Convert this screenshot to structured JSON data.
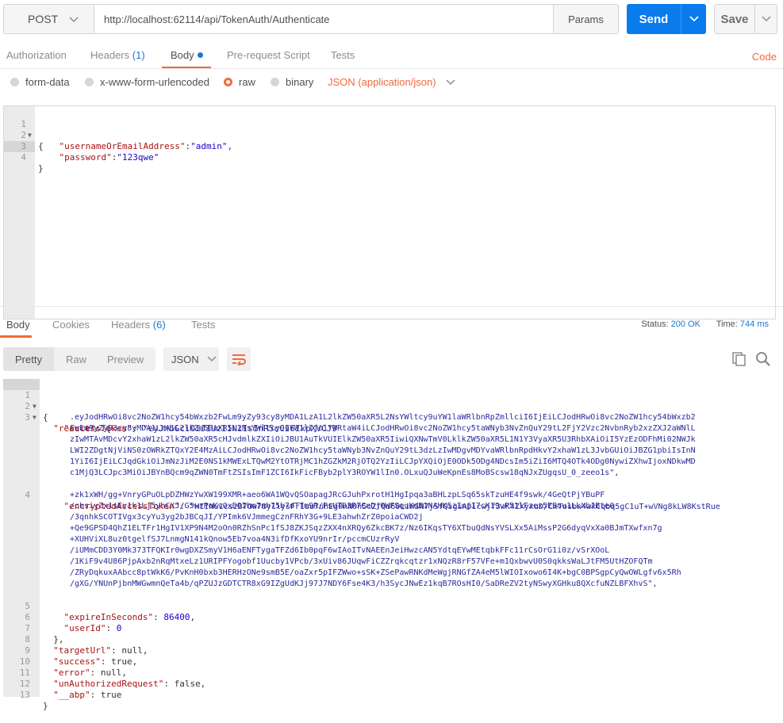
{
  "request": {
    "method": "POST",
    "url": "http://localhost:62114/api/TokenAuth/Authenticate",
    "params_label": "Params",
    "send_label": "Send",
    "save_label": "Save"
  },
  "request_tabs": {
    "authorization": "Authorization",
    "headers": "Headers",
    "headers_count": "(1)",
    "body": "Body",
    "prerequest": "Pre-request Script",
    "tests": "Tests",
    "code": "Code"
  },
  "body_types": {
    "form_data": "form-data",
    "urlencoded": "x-www-form-urlencoded",
    "raw": "raw",
    "binary": "binary",
    "content_type": "JSON (application/json)"
  },
  "request_body": {
    "lines": [
      "1",
      "2",
      "3",
      "4"
    ],
    "l1": "{",
    "l2_key": "\"usernameOrEmailAddress\"",
    "l2_sep": ":",
    "l2_val": "\"admin\"",
    "l2_end": ",",
    "l3_key": "\"password\"",
    "l3_sep": ":",
    "l3_val": "\"123qwe\"",
    "l4": "}"
  },
  "response_tabs": {
    "body": "Body",
    "cookies": "Cookies",
    "headers": "Headers",
    "headers_count": "(6)",
    "tests": "Tests",
    "status_label": "Status:",
    "status_value": "200 OK",
    "time_label": "Time:",
    "time_value": "744 ms"
  },
  "response_toolbar": {
    "pretty": "Pretty",
    "raw": "Raw",
    "preview": "Preview",
    "format": "JSON"
  },
  "response_body": {
    "n1": "1",
    "n2": "2",
    "n3": "3",
    "n4": "4",
    "n5": "5",
    "n6": "6",
    "n7": "7",
    "n8": "8",
    "n9": "9",
    "n10": "10",
    "n11": "11",
    "n12": "12",
    "n13": "13",
    "l1": "{",
    "l2_key": "\"result\"",
    "l2_rest": ": {",
    "l3_key": "\"accessToken\"",
    "l3_val": "\"eyJhbGciOiJIUzI1NiIsInR5cCI6IkpXVCJ9",
    "l3_w1": ".eyJodHRwOi8vc2NoZW1hcy54bWxzb2FwLm9yZy93cy8yMDA1LzA1L2lkZW50aXR5L2NsYWltcy9uYW1laWRlbnRpZmllciI6IjEiLCJodHRwOi8vc2NoZW1hcy54bWxzb2",
    "l3_w2": "FwLm9yZy93cy8yMDA1LzA1L2lkZW50aXR5L2NsYWltcy9uYW1lIjoiYWRtaW4iLCJodHRwOi8vc2NoZW1hcy5taWNyb3NvZnQuY29tL2FjY2Vzc2NvbnRyb2xzZXJ2aWNlL",
    "l3_w3": "zIwMTAvMDcvY2xhaW1zL2lkZW50aXR5cHJvdmlkZXIiOiJBU1AuTkVUIElkZW50aXR5IiwiQXNwTmV0LklkZW50aXR5L1N1Y3VyaXR5U3RhbXAiOiI5YzEzODFhMi02NWJk",
    "l3_w4": "LWI2ZDgtNjViNS0zOWRkZTQxY2E4MzAiLCJodHRwOi8vc2NoZW1hcy5taWNyb3NvZnQuY29tL3dzLzIwMDgvMDYvaWRlbnRpdHkvY2xhaW1zL3JvbGUiOiJBZG1pbiIsInN",
    "l3_w5": "1YiI6IjEiLCJqdGkiOiJmNzJiM2E0NS1kMWExLTQwM2YtOTRjMC1hZGZkM2RjOTQ2YzIiLCJpYXQiOjE0ODk5ODg4NDcsIm5iZiI6MTQ4OTk4ODg0NywiZXhwIjoxNDkwMD",
    "l3_w6": "c1MjQ3LCJpc3MiOiJBYnBQcm9qZWN0TmFtZSIsImF1ZCI6IkFicFByb2plY3ROYW1lIn0.OLxuQJuWeKpnEs8MoBScsw18qNJxZUgqsU_0_zeeo1s\",",
    "l4_key": "\"encryptedAccessToken\"",
    "l4_val": "\"HIINu1cszB7Ow78y1lysFr1uu7uhEg0nNOh5cZfQd60LiWSN7jSfQsgsADicwjf3wK4ZXyxuD/CxTosbw4wkCqbq5gC1uT+wVNg8kLW8KstRue",
    "l4_w1": "+zk1xWH/gg+VnryGPuOLpDZHWzYwXW199XMR+aeo6WA1WQvQSOapagJRcGJuhPxrotH1HgIpqa3aBHLzpLSq65skTzuHE4f9swk/4GeQtPjYBuPF",
    "l4_w2": "/chsiyZx1sEv1k1Lj5yhCXJ/G5wrPoKvQxDOIhm7nh75b7dTTm9R/PsUTD3R7CnDj0WFSquKdB1NAHK5zInjI7cK19vP51lFzex5EBou1LkXbJBte0",
    "l4_w3": "/3qnhkSCOTIVgx3cyYu3yg2bJBCqJI/YPImk6VJmmegCznFRhY3G+9LE3ahwhZrZ0poiaCWD2j",
    "l4_w4": "+Qe9GPSD4QhZ1ELTFr1HgIV1XP9N4M2oOn0RZhSnPc1fSJ8ZKJSqzZXX4nXRQy6ZkcBK7z/Nz6IKqsTY6XTbuQdNsYVSLXx5AiMssP2G6dyqVxXa0BJmTXwfxn7g",
    "l4_w5": "+XUHViXL8uz0tgelfSJ7LnmgN141kQnow5Eb7voa4N3ifDfKxoYU9nrIr/pccmCUzrRyV",
    "l4_w6": "/iUMmCDD3Y0Mk373TFQKIr0wgDXZSmyV1H6aENFTygaTFZd6Ib0pqF6wIAoITvNAEEnJeiHwzcAN5YdtqEYwMEtqbkFFc11rCsOrG1i0z/vSrXOoL",
    "l4_w7": "/1KiF9v4U86PjpAxb2nRqMtxeLz1URIPFYogobf1Uucby1VPcb/3xUiv86JUqwFiCZZrqkcqtzr1xNQzR8rF57VFe+m1QxbwvU0S0qkksWaLJtFM5UtHZOFQTm",
    "l4_w8": "/ZRyDqkuxAAbcc8ptWkK6/PvKnH0bxb3HERHzONe9smB5E/oaZxr5pIFZWwo+sSK+ZSePawRNKdMeWgjRNGfZA4eM5lWIOIxowo6I4K+bgC0BPSgpCyQwOWLgfv6x5Rh",
    "l4_w9": "/gXG/YNUnPjbnMWGwmnQeTa4b/qPZUJzGDTCTR8xG9IZgUdKJj97J7NDY6Fse4K3/h3SycJNwEz1kqB7ROsHI0/SaDReZV2tyNSwyXGHku8QXcfuNZLBFXhvS\",",
    "l5_key": "\"expireInSeconds\"",
    "l5_val": "86400",
    "l6_key": "\"userId\"",
    "l6_val": "0",
    "l7": "},",
    "l8_key": "\"targetUrl\"",
    "l8_rest": ": null,",
    "l9_key": "\"success\"",
    "l9_rest": ": true,",
    "l10_key": "\"error\"",
    "l10_rest": ": null,",
    "l11_key": "\"unAuthorizedRequest\"",
    "l11_rest": ": false,",
    "l12_key": "\"__abp\"",
    "l12_rest": ": true",
    "l13": "}"
  },
  "colors": {
    "accent": "#f26b3a",
    "primary": "#097bed",
    "link": "#1a77d6"
  }
}
